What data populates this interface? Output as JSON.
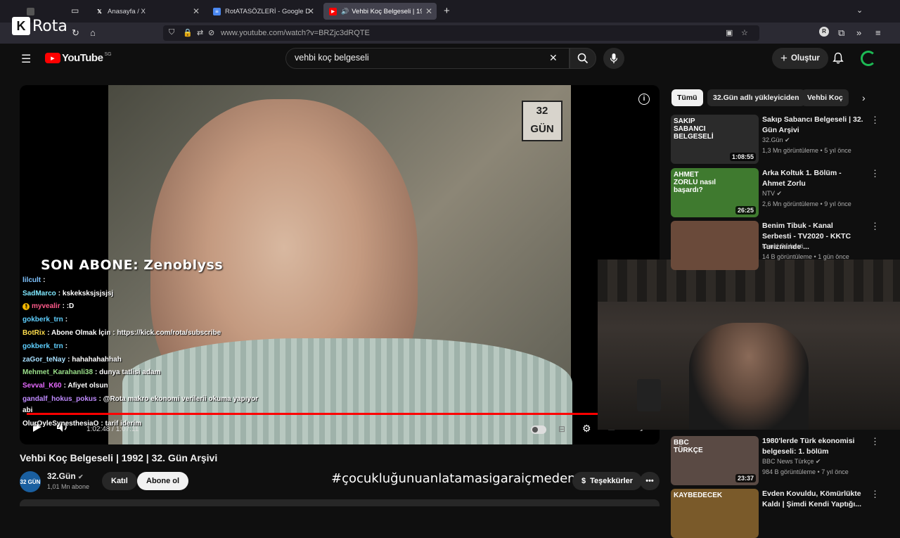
{
  "browser": {
    "tabs": [
      {
        "label": "",
        "icon": "app-icon"
      },
      {
        "label": "Anasayfa / X",
        "icon": "x-icon"
      },
      {
        "label": "RotATASÖZLERİ - Google Dokü",
        "icon": "docs-icon"
      },
      {
        "label": "Vehbi Koç Belgeseli | 1992 |",
        "icon": "youtube-icon"
      }
    ],
    "url": "www.youtube.com/watch?v=BRZjc3dRQTE"
  },
  "stream_logo": "Rota",
  "youtube": {
    "logo_text": "YouTube",
    "region": "SG",
    "search_value": "vehbi koç belgeseli",
    "create_label": "Oluştur"
  },
  "player": {
    "channel_watermark": "32 GÜN",
    "time": "1:02:48 / 1:07:11",
    "progress": 0.935
  },
  "overlay": {
    "son_abone": "SON ABONE: Zenoblyss",
    "chat": [
      {
        "user": "lilcult",
        "color": "#7fc3ff",
        "msg": ":",
        "badge": ""
      },
      {
        "user": "SadMarco",
        "color": "#7fe8ff",
        "msg": ": kskeksksjsjsjsj",
        "badge": ""
      },
      {
        "user": "myvealir",
        "color": "#ff5a8a",
        "msg": ": :D",
        "badge": "!"
      },
      {
        "user": "gokberk_trn",
        "color": "#5fd0ff",
        "msg": ":",
        "badge": ""
      },
      {
        "user": "BotRix",
        "color": "#ffde4d",
        "msg": ": Abone Olmak İçin : https://kick.com/rota/subscribe",
        "badge": ""
      },
      {
        "user": "gokberk_trn",
        "color": "#5fd0ff",
        "msg": ":",
        "badge": ""
      },
      {
        "user": "zaGor_teNay",
        "color": "#a8e0ff",
        "msg": ": hahahahahhah",
        "badge": ""
      },
      {
        "user": "Mehmet_Karahanli38",
        "color": "#9be08a",
        "msg": ": dunya tatlisi adam",
        "badge": ""
      },
      {
        "user": "Sevval_K60",
        "color": "#e76aff",
        "msg": ": Afiyet olsun",
        "badge": ""
      },
      {
        "user": "gandalf_hokus_pokus",
        "color": "#c08bff",
        "msg": ": @Rota makro ekonomi verilerii okuma yapıyor",
        "badge": ""
      },
      {
        "user": "",
        "color": "#ffffff",
        "msg": "abi",
        "badge": ""
      },
      {
        "user": "OlurOyleSynesthesiaO",
        "color": "#ffffff",
        "msg": ": tarif iderim",
        "badge": ""
      }
    ]
  },
  "video": {
    "title": "Vehbi Koç Belgeseli | 1992 | 32. Gün Arşivi",
    "channel": "32.Gün",
    "channel_avatar": "32 GÜN",
    "subscribers": "1,01 Mn abone",
    "join_label": "Katıl",
    "subscribe_label": "Abone ol",
    "thanks_label": "Teşekkürler",
    "hashtag": "#çocukluğunuanlatamasigaraiçmeden"
  },
  "sidebar": {
    "chips": [
      "Tümü",
      "32.Gün adlı yükleyiciden",
      "Vehbi Koç"
    ],
    "recs": [
      {
        "title": "Sakıp Sabancı Belgeseli | 32. Gün Arşivi",
        "channel": "32.Gün",
        "verified": true,
        "meta": "1,3 Mn görüntüleme • 5 yıl önce",
        "duration": "1:08:55",
        "thumb_text": "SAKIP SABANCI BELGESELİ",
        "thumb_color": "#2b2b2b"
      },
      {
        "title": "Arka Koltuk 1. Bölüm - Ahmet Zorlu",
        "channel": "NTV",
        "verified": true,
        "meta": "2,6 Mn görüntüleme • 9 yıl önce",
        "duration": "26:25",
        "thumb_text": "AHMET ZORLU nasıl başardı?",
        "thumb_color": "#3f7a2f"
      },
      {
        "title": "Benim Tibuk - Kanal Serbesti - TV2020 - KKTC Turizminde ...",
        "channel": "Kanal Serbesti",
        "verified": false,
        "meta": "14 B görüntüleme • 1 gün önce",
        "duration": "",
        "thumb_text": "",
        "thumb_color": "#6a4a3a"
      },
      {
        "title": "1980'lerde Türk ekonomisi belgeseli: 1. bölüm",
        "channel": "BBC News Türkçe",
        "verified": true,
        "meta": "984 B görüntüleme • 7 yıl önce",
        "duration": "23:37",
        "thumb_text": "BBC TÜRKÇE",
        "thumb_color": "#5a4a44"
      },
      {
        "title": "Evden Kovuldu, Kömürlükte Kaldı | Şimdi Kendi Yaptığı...",
        "channel": "",
        "verified": false,
        "meta": "",
        "duration": "",
        "thumb_text": "KAYBEDECEK",
        "thumb_color": "#7a5a2a"
      }
    ]
  }
}
